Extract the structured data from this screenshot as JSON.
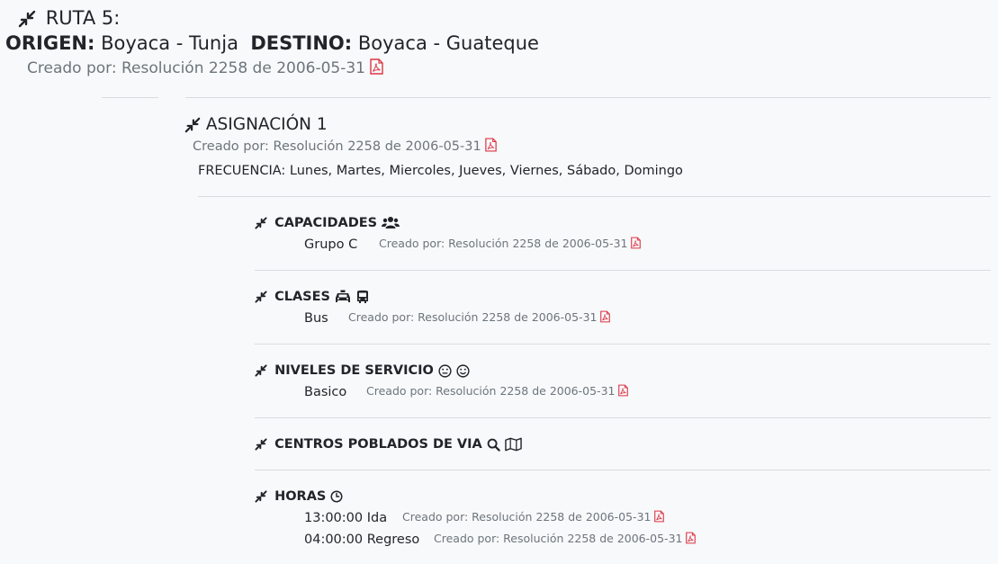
{
  "route": {
    "title": "RUTA 5:",
    "origin_label": "ORIGEN:",
    "origin_value": "Boyaca - Tunja",
    "destination_label": "DESTINO:",
    "destination_value": "Boyaca - Guateque",
    "created": "Creado por: Resolución 2258 de 2006-05-31"
  },
  "assignment": {
    "title": "ASIGNACIÓN 1",
    "created": "Creado por: Resolución 2258 de 2006-05-31",
    "frequency": "FRECUENCIA: Lunes, Martes, Miercoles, Jueves, Viernes, Sábado, Domingo"
  },
  "sections": {
    "capacidades": {
      "title": "CAPACIDADES",
      "value": "Grupo C",
      "created": "Creado por: Resolución 2258 de 2006-05-31"
    },
    "clases": {
      "title": "CLASES",
      "value": "Bus",
      "created": "Creado por: Resolución 2258 de 2006-05-31"
    },
    "niveles": {
      "title": "NIVELES DE SERVICIO",
      "value": "Basico",
      "created": "Creado por: Resolución 2258 de 2006-05-31"
    },
    "centros": {
      "title": "CENTROS POBLADOS DE VIA"
    },
    "horas": {
      "title": "HORAS",
      "rows": [
        {
          "value": "13:00:00 Ida",
          "created": "Creado por: Resolución 2258 de 2006-05-31"
        },
        {
          "value": "04:00:00 Regreso",
          "created": "Creado por: Resolución 2258 de 2006-05-31"
        }
      ]
    }
  },
  "icons": {
    "collapse": "compress-arrows-icon",
    "pdf": "file-pdf-icon",
    "users": "users-icon",
    "taxi": "taxi-icon",
    "bus": "bus-icon",
    "meh": "meh-face-icon",
    "smile": "smile-face-icon",
    "search": "search-icon",
    "map": "map-icon",
    "clock": "clock-icon"
  },
  "colors": {
    "background": "#f8f9fa",
    "text": "#212529",
    "muted": "#6c757d",
    "pdf_red": "#dc3545",
    "divider": "#d9dcdf"
  }
}
